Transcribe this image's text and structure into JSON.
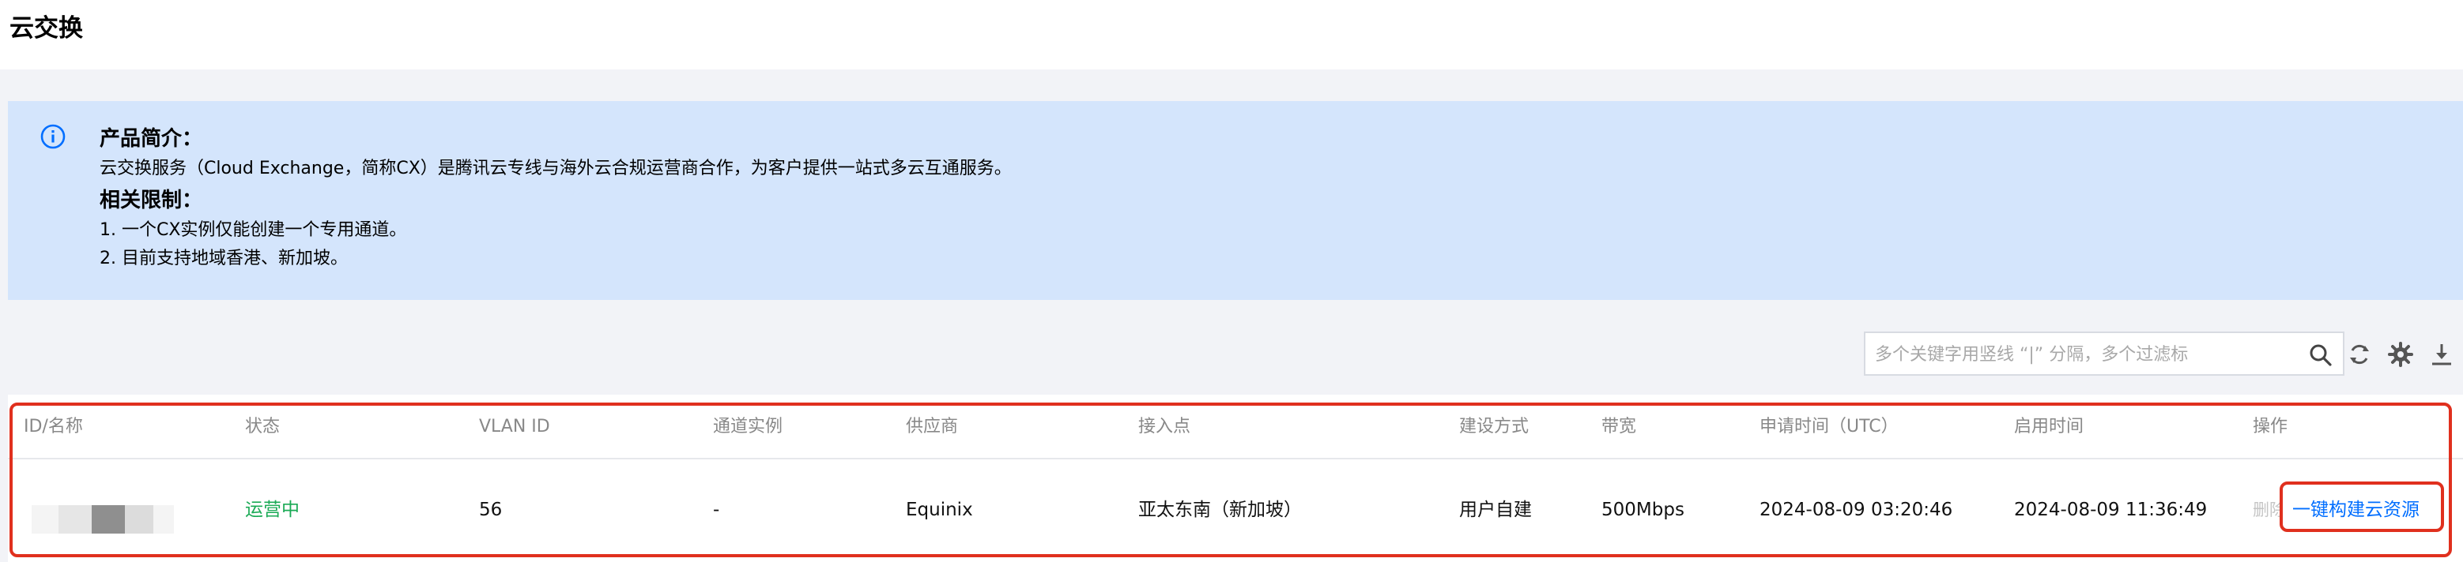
{
  "header": {
    "title": "云交换"
  },
  "notice": {
    "heading1": "产品简介：",
    "text1": "云交换服务（Cloud Exchange，简称CX）是腾讯云专线与海外云合规运营商合作，为客户提供一站式多云互通服务。",
    "heading2": "相关限制：",
    "item1": "1. 一个CX实例仅能创建一个专用通道。",
    "item2": "2. 目前支持地域香港、新加坡。"
  },
  "toolbar": {
    "search_placeholder": "多个关键字用竖线 “|” 分隔，多个过滤标",
    "icons": [
      "search-icon",
      "refresh-icon",
      "settings-icon",
      "download-icon"
    ]
  },
  "table": {
    "columns": [
      "ID/名称",
      "状态",
      "VLAN ID",
      "通道实例",
      "供应商",
      "接入点",
      "建设方式",
      "带宽",
      "申请时间（UTC）",
      "启用时间",
      "操作"
    ],
    "rows": [
      {
        "status": "运营中",
        "vlan_id": "56",
        "channel": "-",
        "vendor": "Equinix",
        "access_point": "亚太东南（新加坡）",
        "build_mode": "用户自建",
        "bandwidth": "500Mbps",
        "apply_time": "2024-08-09 03:20:46",
        "enable_time": "2024-08-09 11:36:49",
        "op_delete": "删除",
        "op_build": "一键构建云资源"
      }
    ]
  },
  "colors": {
    "accent": "#006eff",
    "running": "#1aaa55",
    "highlight": "#e0301e",
    "notice_bg": "#d4e5fc"
  }
}
